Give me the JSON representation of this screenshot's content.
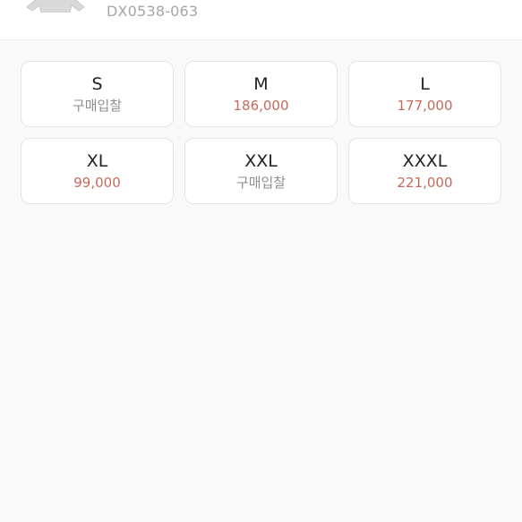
{
  "product": {
    "thumbnail_icon": "sweatshirt-thumbnail",
    "code": "DX0538-063"
  },
  "sizes": [
    {
      "name": "S",
      "price": "구매입찰",
      "status": "bid"
    },
    {
      "name": "M",
      "price": "186,000",
      "status": "price"
    },
    {
      "name": "L",
      "price": "177,000",
      "status": "price"
    },
    {
      "name": "XL",
      "price": "99,000",
      "status": "price"
    },
    {
      "name": "XXL",
      "price": "구매입찰",
      "status": "bid"
    },
    {
      "name": "XXXL",
      "price": "221,000",
      "status": "price"
    }
  ],
  "colors": {
    "price": "#c46a5a",
    "bid": "#8f8f8f"
  }
}
